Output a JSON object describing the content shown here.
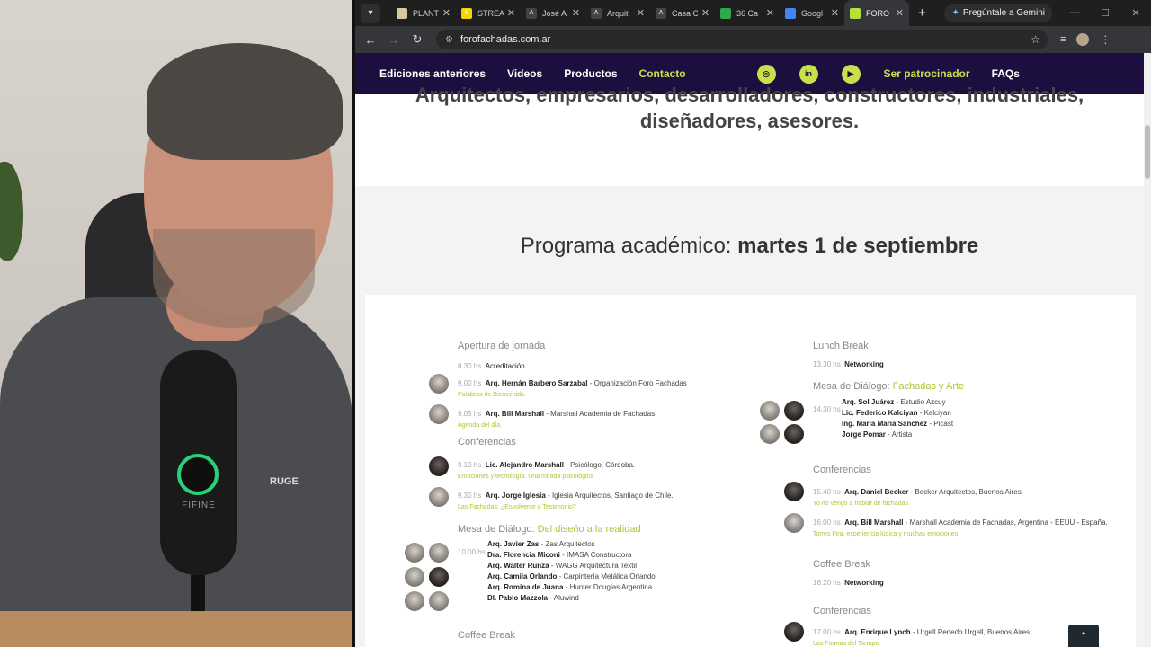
{
  "tabs": [
    {
      "title": "PLANT",
      "color": "#d8c8a0",
      "glyph": ""
    },
    {
      "title": "STREA",
      "color": "#f2d700",
      "glyph": "S"
    },
    {
      "title": "José A",
      "color": "#444",
      "glyph": "A"
    },
    {
      "title": "Arquit",
      "color": "#444",
      "glyph": "A"
    },
    {
      "title": "Casa C",
      "color": "#444",
      "glyph": "A"
    },
    {
      "title": "36 Ca",
      "color": "#2ea84a",
      "glyph": ""
    },
    {
      "title": "Googl",
      "color": "#4285f4",
      "glyph": ""
    },
    {
      "title": "FORO",
      "color": "#b6e03a",
      "glyph": ""
    }
  ],
  "gemini_label": "Pregúntale a Gemini",
  "url": "forofachadas.com.ar",
  "site_nav": {
    "ediciones": "Ediciones anteriores",
    "videos": "Videos",
    "productos": "Productos",
    "contacto": "Contacto",
    "patrocinador": "Ser patrocinador",
    "faqs": "FAQs"
  },
  "hero": {
    "line1": "Arquitectos, empresarios, desarrolladores, constructores, industriales,",
    "line2": "diseñadores, asesores."
  },
  "program": {
    "title_prefix": "Programa académico: ",
    "title_bold": "martes 1 de septiembre"
  },
  "left": {
    "apertura": "Apertura de jornada",
    "acred_time": "8.30 hs",
    "acred": "Acreditación",
    "r1": {
      "time": "9.00 hs",
      "name": "Arq. Hernán Barbero Sarzabal",
      "org": " - Organización Foro Fachadas",
      "topic": "Palabras de Bienvenida."
    },
    "r2": {
      "time": "9.05 hs",
      "name": "Arq. Bill Marshall",
      "org": " - Marshall Academia de Fachadas",
      "topic": "Agenda del día."
    },
    "conferencias": "Conferencias",
    "r3": {
      "time": "9.10 hs",
      "name": "Lic. Alejandro Marshall",
      "org": " - Psicólogo, Córdoba.",
      "topic": "Emociones y tecnología. Una mirada psicológica"
    },
    "r4": {
      "time": "9.30 hs",
      "name": "Arq. Jorge Iglesia",
      "org": " - Iglesia Arquitectos, Santiago de Chile.",
      "topic": "Las Fachadas: ¿Envolvente o Testimonio?"
    },
    "mesa": "Mesa de Diálogo: ",
    "mesa_acc": "Del diseño a la realidad",
    "mesa_time": "10.00 hs",
    "mesa_people": [
      {
        "name": "Arq. Javier Zas",
        "org": " - Zas Arquitectos"
      },
      {
        "name": "Dra. Florencia Miconi",
        "org": " - IMASA Constructora"
      },
      {
        "name": "Arq. Walter Runza",
        "org": " - WAGG Arquitectura Textil"
      },
      {
        "name": "Arq. Camila Orlando",
        "org": " - Carpintería Metálica Orlando"
      },
      {
        "name": "Arq. Romina de Juana",
        "org": " - Hunter Douglas Argentina"
      },
      {
        "name": "DI. Pablo Mazzola",
        "org": " - Aluwind"
      }
    ],
    "coffee": "Coffee Break"
  },
  "right": {
    "lunch": "Lunch Break",
    "lunch_time": "13.30 hs",
    "lunch_net": "Networking",
    "mesa": "Mesa de Diálogo: ",
    "mesa_acc": "Fachadas y Arte",
    "mesa_time": "14.30 hs",
    "mesa_people": [
      {
        "name": "Arq. Sol Juárez",
        "org": " - Estudio Azcuy"
      },
      {
        "name": "Lic. Federico Kalciyan",
        "org": " - Kalciyan"
      },
      {
        "name": "Ing. María María Sanchez",
        "org": " - Picast"
      },
      {
        "name": "Jorge Pomar",
        "org": " - Artista"
      }
    ],
    "conferencias": "Conferencias",
    "r1": {
      "time": "15.40 hs",
      "name": "Arq. Daniel Becker",
      "org": " - Becker Arquitectos, Buenos Aires.",
      "topic": "Yo no vengo a hablar de fachadas."
    },
    "r2": {
      "time": "16.00 hs",
      "name": "Arq. Bill Marshall",
      "org": " - Marshall Academia de Fachadas, Argentina - EEUU - España.",
      "topic": "Torres Fira, experiencia lúdica y muchas emociones."
    },
    "coffee": "Coffee Break",
    "coffee_time": "16.20 hs",
    "coffee_net": "Networking",
    "conferencias2": "Conferencias",
    "r3": {
      "time": "17.00 hs",
      "name": "Arq. Enrique Lynch",
      "org": " - Urgell Penedo Urgell, Buenos Aires.",
      "topic": "Las Formas del Tiempo."
    }
  },
  "colors": {
    "nav_bg": "#1c0f3f",
    "accent": "#c8e04a",
    "topic": "#a8c83a"
  },
  "icons": [
    "instagram-icon",
    "linkedin-icon",
    "youtube-icon",
    "scroll-to-top-icon"
  ],
  "webcam": {
    "mic_brand": "FIFINE",
    "shirt_logo": "RUGE"
  }
}
